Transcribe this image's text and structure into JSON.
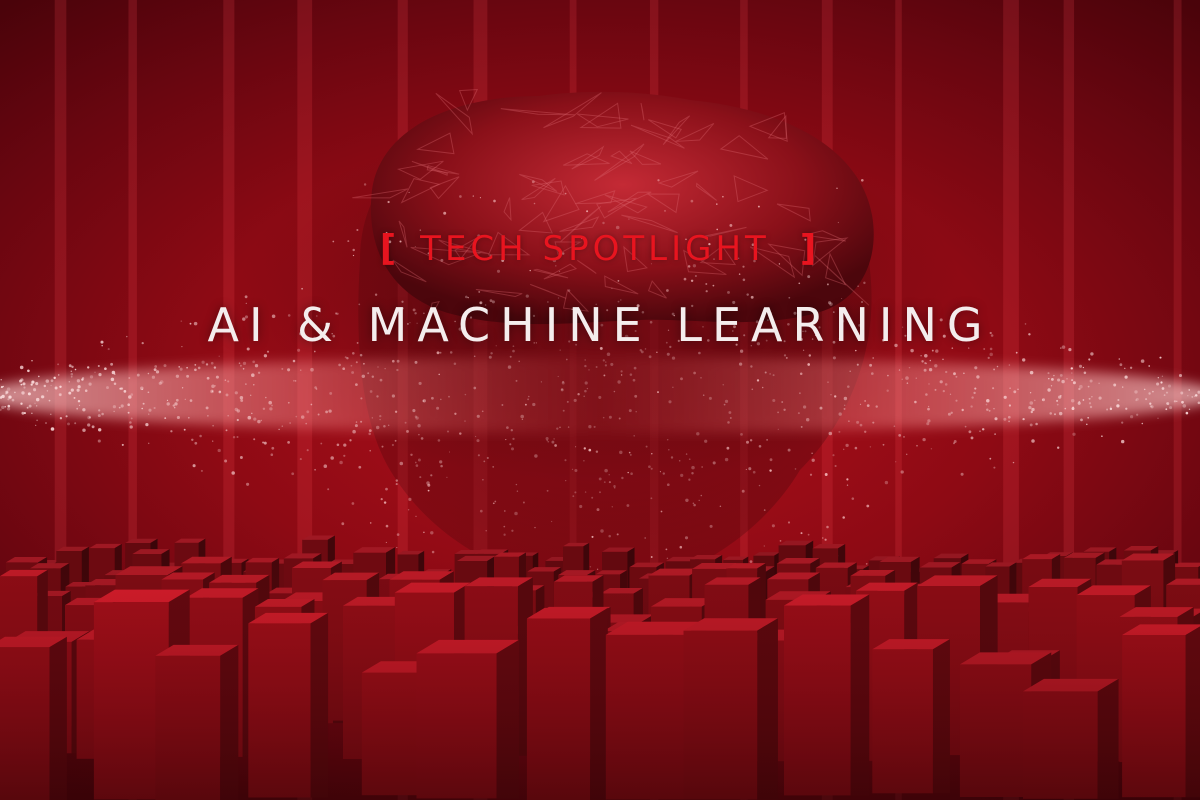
{
  "hero": {
    "kicker_open": "[",
    "kicker_text": "TECH SPOTLIGHT",
    "kicker_close": "]",
    "headline": "AI & MACHINE LEARNING"
  },
  "colors": {
    "background": "#8e0a14",
    "kicker": "#e8141f",
    "headline": "#f4eded"
  },
  "illustration": {
    "subjects": [
      "brain-icon",
      "particle-stream",
      "cube-field"
    ]
  }
}
